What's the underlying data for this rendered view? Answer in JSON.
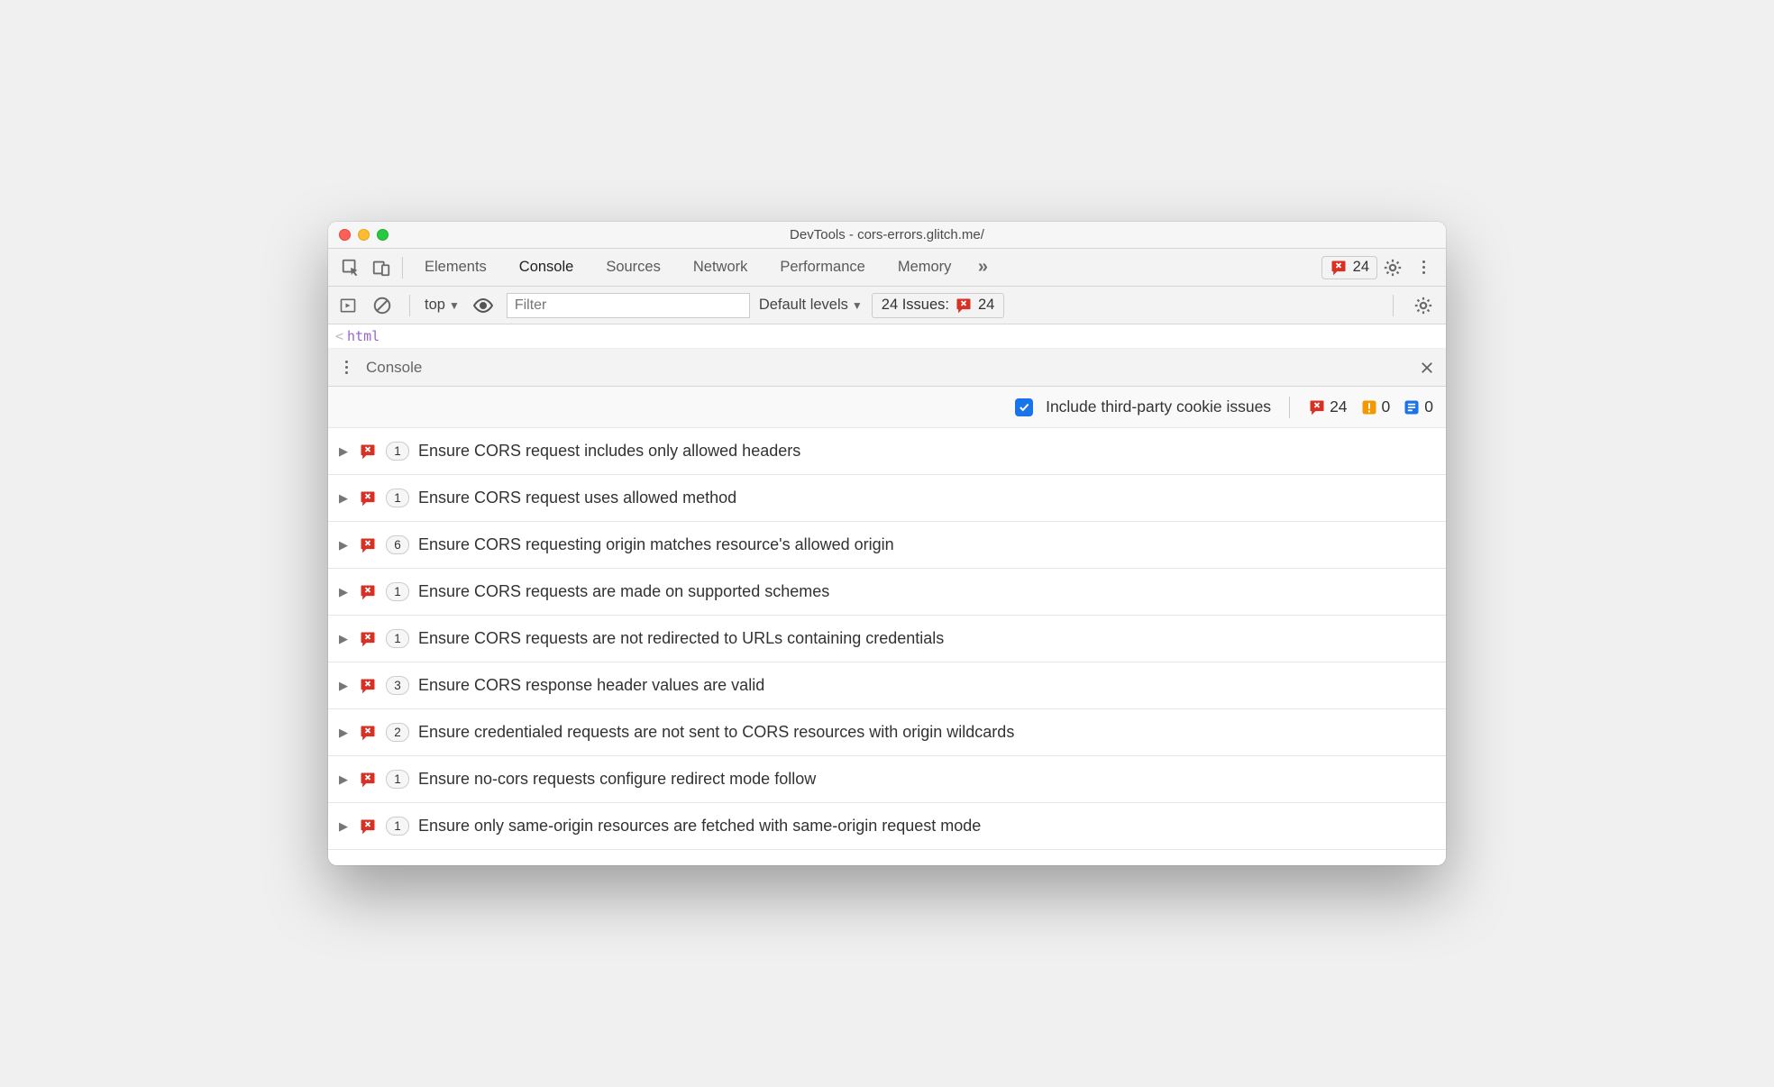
{
  "window": {
    "title": "DevTools - cors-errors.glitch.me/"
  },
  "tabs": {
    "items": [
      "Elements",
      "Console",
      "Sources",
      "Network",
      "Performance",
      "Memory"
    ],
    "active_index": 1,
    "error_count": "24"
  },
  "toolbar": {
    "context": "top",
    "filter_placeholder": "Filter",
    "levels": "Default levels",
    "issues_label": "24 Issues:",
    "issues_count": "24"
  },
  "code_hint": {
    "tag": "html"
  },
  "drawer": {
    "title": "Console"
  },
  "summary": {
    "checkbox_label": "Include third-party cookie issues",
    "errors": "24",
    "warnings": "0",
    "info": "0"
  },
  "issues": [
    {
      "count": "1",
      "text": "Ensure CORS request includes only allowed headers"
    },
    {
      "count": "1",
      "text": "Ensure CORS request uses allowed method"
    },
    {
      "count": "6",
      "text": "Ensure CORS requesting origin matches resource's allowed origin"
    },
    {
      "count": "1",
      "text": "Ensure CORS requests are made on supported schemes"
    },
    {
      "count": "1",
      "text": "Ensure CORS requests are not redirected to URLs containing credentials"
    },
    {
      "count": "3",
      "text": "Ensure CORS response header values are valid"
    },
    {
      "count": "2",
      "text": "Ensure credentialed requests are not sent to CORS resources with origin wildcards"
    },
    {
      "count": "1",
      "text": "Ensure no-cors requests configure redirect mode follow"
    },
    {
      "count": "1",
      "text": "Ensure only same-origin resources are fetched with same-origin request mode"
    }
  ]
}
